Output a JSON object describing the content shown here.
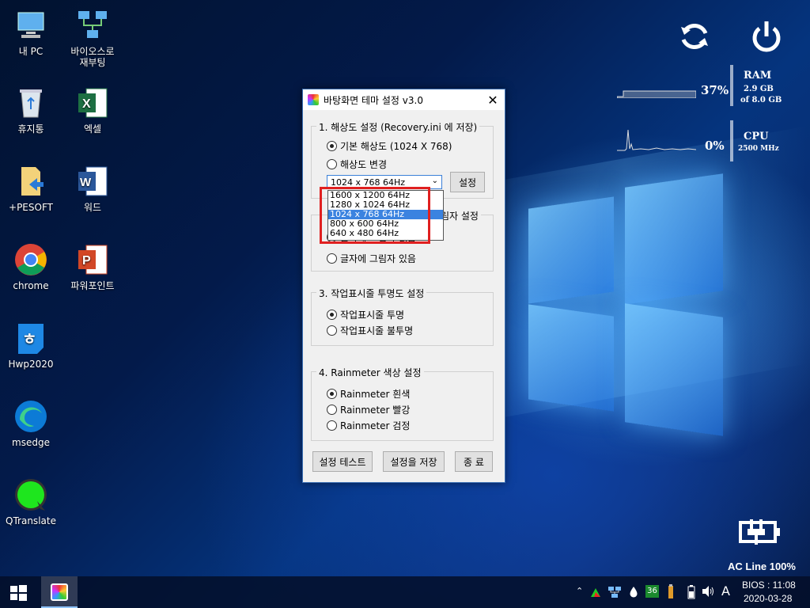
{
  "desktop": {
    "icons": [
      {
        "label_line1": "내 PC",
        "label_line2": ""
      },
      {
        "label_line1": "바이오스로",
        "label_line2": "재부팅"
      },
      {
        "label_line1": "휴지통",
        "label_line2": ""
      },
      {
        "label_line1": "엑셀",
        "label_line2": ""
      },
      {
        "label_line1": "+PESOFT",
        "label_line2": ""
      },
      {
        "label_line1": "워드",
        "label_line2": ""
      },
      {
        "label_line1": "chrome",
        "label_line2": ""
      },
      {
        "label_line1": "파워포인트",
        "label_line2": ""
      },
      {
        "label_line1": "Hwp2020",
        "label_line2": ""
      },
      {
        "label_line1": "msedge",
        "label_line2": ""
      },
      {
        "label_line1": "QTranslate",
        "label_line2": ""
      }
    ]
  },
  "dialog": {
    "title": "바탕화면 테마 설정 v3.0",
    "close_label": "✕",
    "group1": {
      "legend": "1. 해상도 설정 (Recovery.ini 에 저장)",
      "radio_default": "기본 해상도 (1024 X 768)",
      "radio_change": "해상도 변경",
      "select_value": "1024 x 768  64Hz",
      "set_button": "설정"
    },
    "dropdown_options": [
      "1600 x 1200  64Hz",
      "1280 x 1024  64Hz",
      "1024 x 768  64Hz",
      "800 x 600  64Hz",
      "640 x 480  64Hz"
    ],
    "group2": {
      "legend_fragment": "림자 설정",
      "radio_no_shadow_fragment": "글자에 그림자 없음",
      "radio_shadow": "글자에 그림자 있음"
    },
    "group3": {
      "legend": "3. 작업표시줄 투명도 설정",
      "radio_transparent": "작업표시줄 투명",
      "radio_opaque": "작업표시줄 불투명"
    },
    "group4": {
      "legend": "4. Rainmeter 색상 설정",
      "radio_white": "Rainmeter 흰색",
      "radio_red": "Rainmeter 빨강",
      "radio_black": "Rainmeter 검정"
    },
    "buttons": {
      "test": "설정 테스트",
      "save": "설정을 저장",
      "exit": "종 료"
    }
  },
  "widgets": {
    "ram": {
      "label": "RAM",
      "percent": "37%",
      "used": "2.9 GB",
      "total": "of 8.0 GB"
    },
    "cpu": {
      "label": "CPU",
      "percent": "0%",
      "freq": "2500 MHz"
    },
    "power": {
      "status": "AC Line 100%"
    }
  },
  "taskbar": {
    "tray_badge": "36",
    "ime": "A",
    "clock_line1": "BIOS : 11:08",
    "clock_line2": "2020-03-28"
  }
}
